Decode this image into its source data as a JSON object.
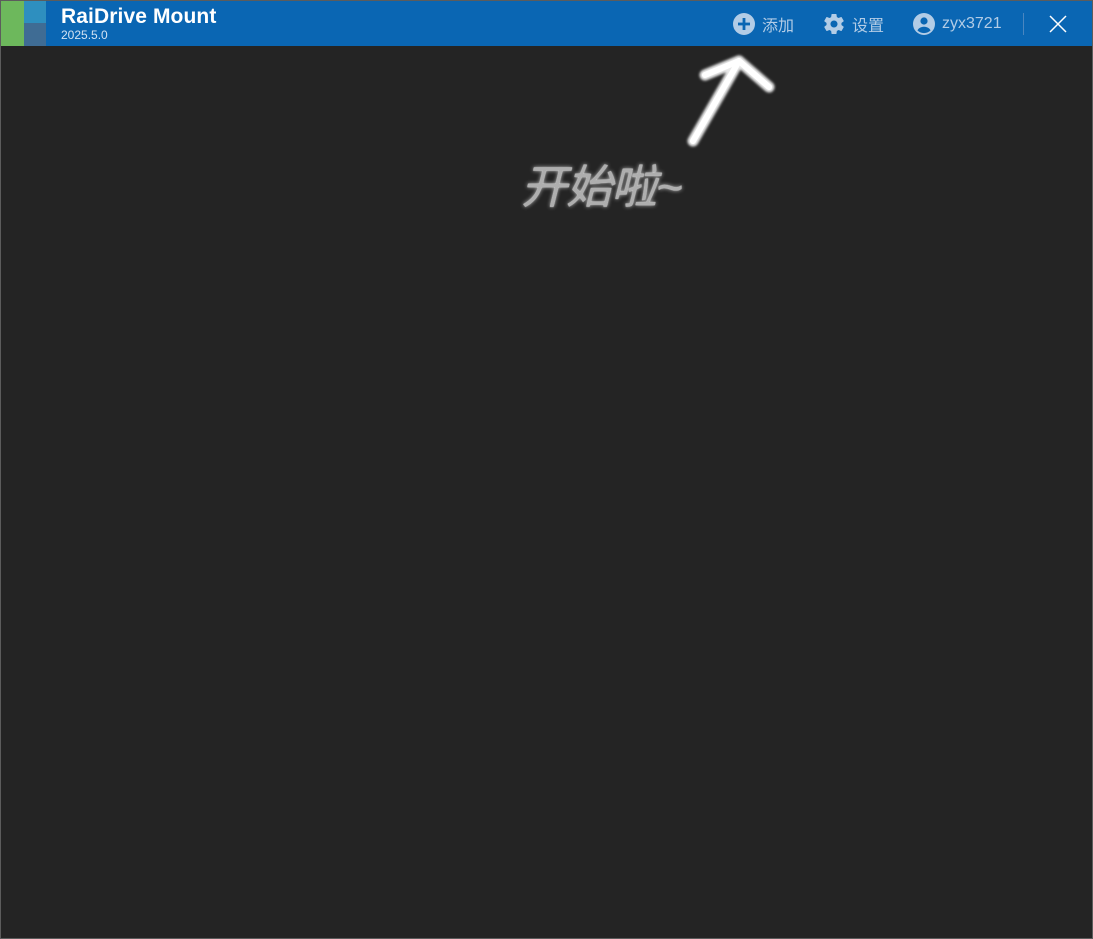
{
  "window": {
    "title": "RaiDrive Mount",
    "version": "2025.5.0"
  },
  "toolbar": {
    "add_label": "添加",
    "settings_label": "设置",
    "user_label": "zyx3721"
  },
  "main": {
    "hint_text": "开始啦~"
  },
  "colors": {
    "titlebar": "#0a66b3",
    "background": "#242424",
    "toolbar_text": "#b2cce6",
    "logo_green": "#6db85c",
    "logo_teal": "#2e8fbf",
    "logo_slate": "#3f6c94"
  },
  "icons": {
    "add": "plus-circle-icon",
    "settings": "gear-icon",
    "user": "user-circle-icon",
    "close": "close-icon",
    "annotation": "arrow-up-icon"
  }
}
